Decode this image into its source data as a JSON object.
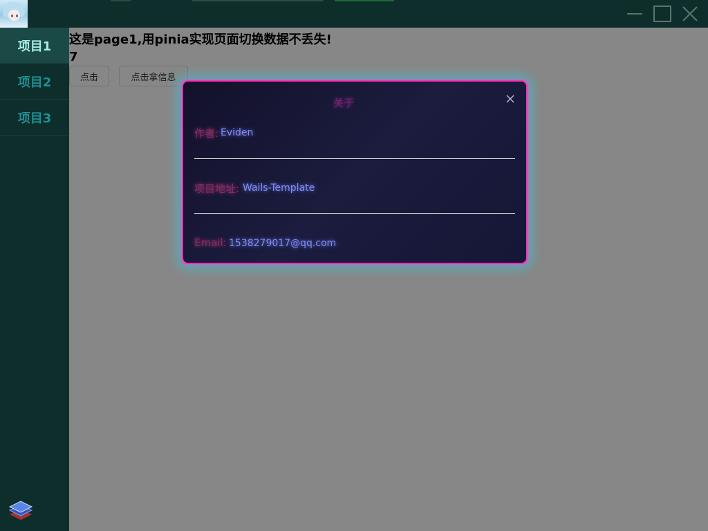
{
  "window": {
    "controls": {
      "minimize": "minimize-icon",
      "maximize": "maximize-icon",
      "close": "close-icon"
    }
  },
  "sidebar": {
    "items": [
      {
        "label": "项目1",
        "active": true
      },
      {
        "label": "项目2",
        "active": false
      },
      {
        "label": "项目3",
        "active": false
      }
    ],
    "footer_icon": "layers-icon"
  },
  "main": {
    "headline": "这是page1,用pinia实现页面切换数据不丢失!",
    "counter": "7",
    "buttons": {
      "click": "点击",
      "get_info": "点击拿信息"
    }
  },
  "modal": {
    "title": "关于",
    "author_label": "作者:",
    "author_value": "Eviden",
    "project_label": "项目地址:",
    "project_value": "Wails-Template",
    "email_label": "Email:",
    "email_value": "1538279017@qq.com"
  },
  "colors": {
    "sidebar_bg": "#0e2e2b",
    "nav_text": "#1d8f95",
    "nav_active_text": "#a7ede6",
    "modal_border": "#ff2fb2",
    "modal_glow": "#40c4d6",
    "link_value": "#7f8cf5"
  }
}
